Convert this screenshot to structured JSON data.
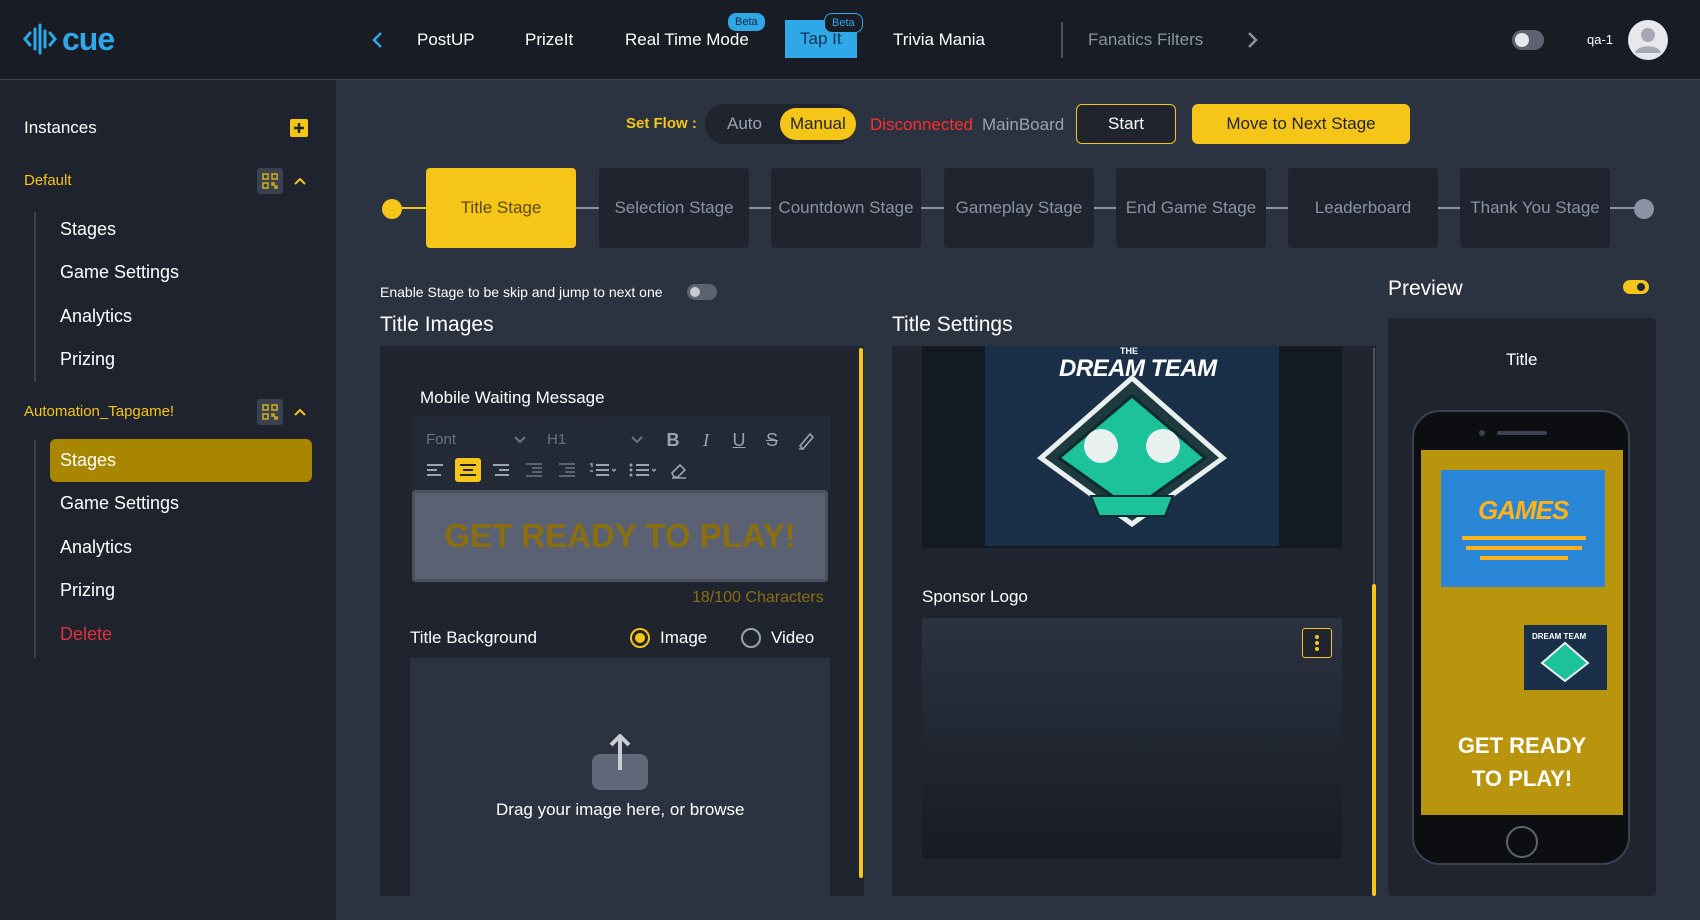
{
  "app": {
    "logo": "cue",
    "user": "qa-1"
  },
  "nav": {
    "tabs": [
      {
        "label": "PostUP"
      },
      {
        "label": "PrizeIt"
      },
      {
        "label": "Real Time Mode",
        "badge": "Beta"
      },
      {
        "label": "Tap It",
        "badge": "Beta"
      },
      {
        "label": "Trivia Mania"
      },
      {
        "label": "Fanatics Filters"
      }
    ]
  },
  "sidebar": {
    "title": "Instances",
    "groups": [
      {
        "name": "Default",
        "items": [
          "Stages",
          "Game Settings",
          "Analytics",
          "Prizing"
        ]
      },
      {
        "name": "Automation_Tapgame!",
        "items": [
          "Stages",
          "Game Settings",
          "Analytics",
          "Prizing",
          "Delete"
        ]
      }
    ]
  },
  "flow": {
    "label": "Set Flow :",
    "options": [
      "Auto",
      "Manual"
    ],
    "selected": "Manual",
    "status": "Disconnected",
    "board": "MainBoard",
    "start_label": "Start",
    "next_label": "Move to Next Stage"
  },
  "stages": [
    "Title Stage",
    "Selection Stage",
    "Countdown Stage",
    "Gameplay Stage",
    "End Game Stage",
    "Leaderboard",
    "Thank You Stage"
  ],
  "skip_label": "Enable Stage to be skip and jump to next one",
  "title_images": {
    "heading": "Title Images",
    "waiting_label": "Mobile Waiting Message",
    "font_placeholder": "Font",
    "heading_select": "H1",
    "editor_text": "GET READY TO PLAY!",
    "char_count": "18/100 Characters",
    "bg_label": "Title Background",
    "bg_options": [
      "Image",
      "Video"
    ],
    "bg_selected": "Image",
    "upload_text": "Drag your image here, or browse"
  },
  "title_settings": {
    "heading": "Title Settings",
    "logo_text": "DREAM TEAM",
    "logo_top": "THE",
    "sponsor_label": "Sponsor Logo"
  },
  "preview": {
    "heading": "Preview",
    "screen_label": "Title",
    "games_text": "GAMES",
    "mini_logo": "DREAM TEAM",
    "message_line1": "GET READY",
    "message_line2": "TO PLAY!"
  },
  "colors": {
    "accent": "#f5c518",
    "brand": "#2fa8e8",
    "danger": "#ff2d2d"
  }
}
